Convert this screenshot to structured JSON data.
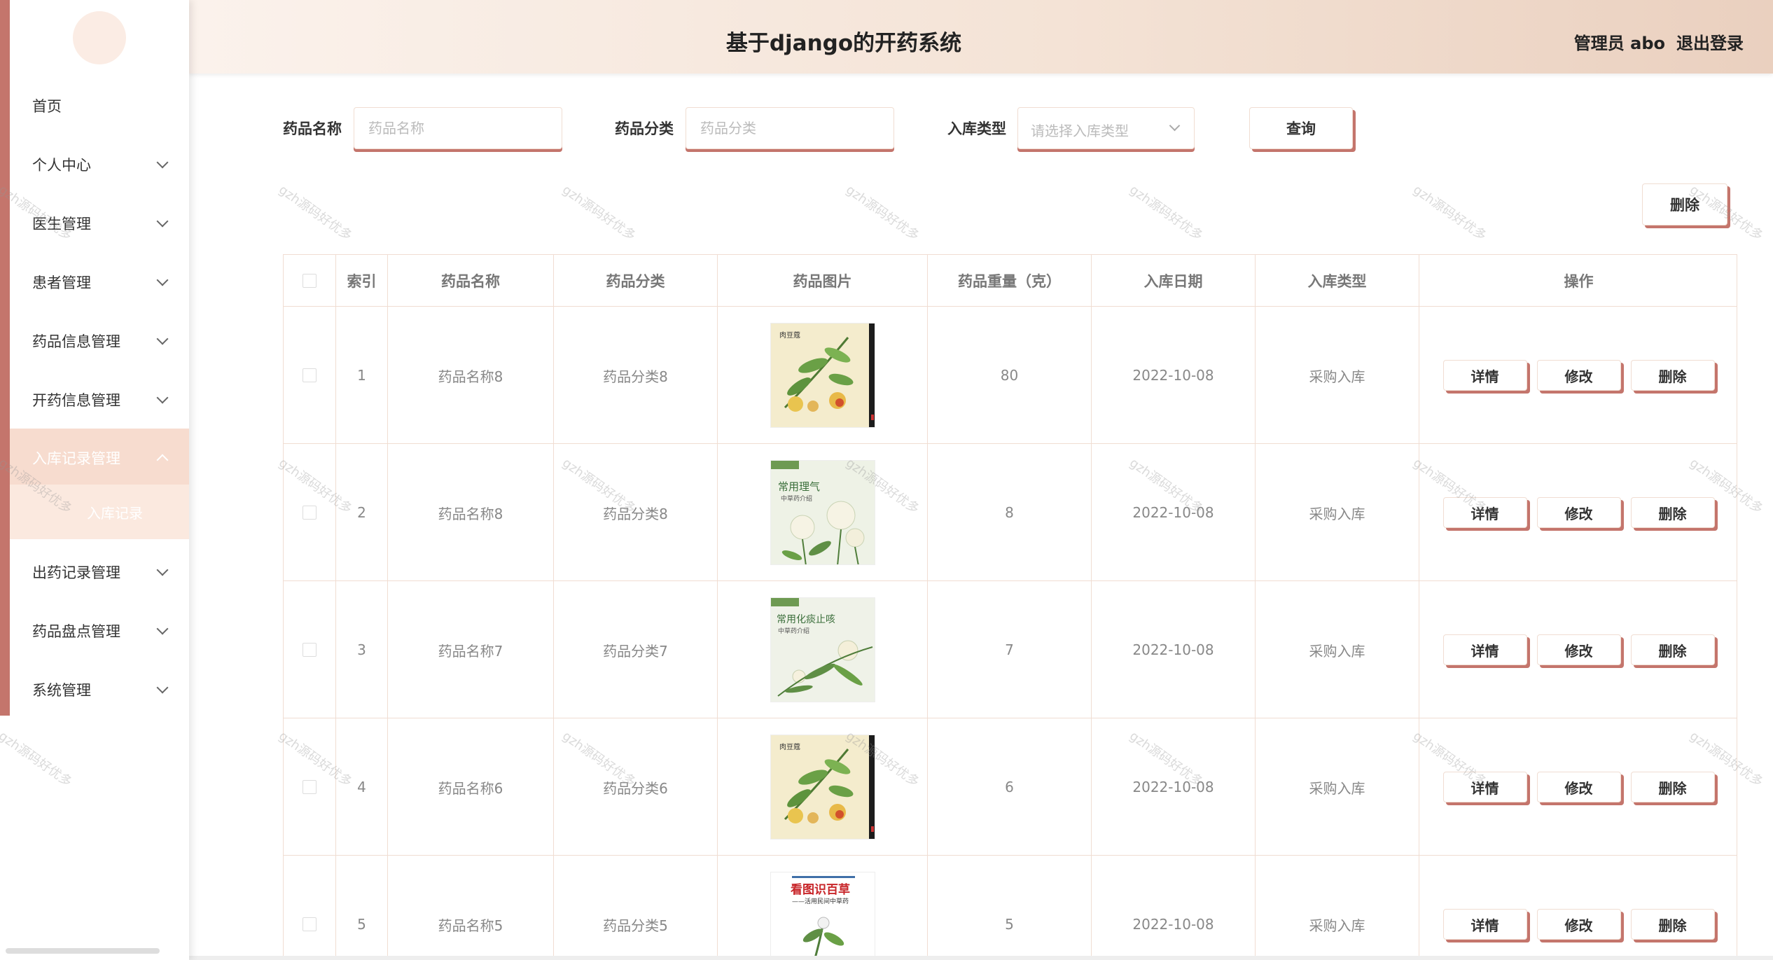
{
  "header": {
    "title": "基于django的开药系统",
    "user_label": "管理员 abo",
    "logout_label": "退出登录"
  },
  "sidebar": {
    "items": [
      {
        "label": "首页"
      },
      {
        "label": "个人中心"
      },
      {
        "label": "医生管理"
      },
      {
        "label": "患者管理"
      },
      {
        "label": "药品信息管理"
      },
      {
        "label": "开药信息管理"
      },
      {
        "label": "入库记录管理"
      },
      {
        "label": "出药记录管理"
      },
      {
        "label": "药品盘点管理"
      },
      {
        "label": "系统管理"
      }
    ],
    "submenu": {
      "label": "入库记录"
    }
  },
  "search": {
    "name_label": "药品名称",
    "name_placeholder": "药品名称",
    "category_label": "药品分类",
    "category_placeholder": "药品分类",
    "type_label": "入库类型",
    "type_placeholder": "请选择入库类型",
    "query_label": "查询"
  },
  "toolbar": {
    "delete_label": "删除"
  },
  "table": {
    "columns": [
      "索引",
      "药品名称",
      "药品分类",
      "药品图片",
      "药品重量（克）",
      "入库日期",
      "入库类型",
      "操作"
    ],
    "actions": {
      "detail": "详情",
      "edit": "修改",
      "delete": "删除"
    },
    "rows": [
      {
        "index": "1",
        "name": "药品名称8",
        "category": "药品分类8",
        "image": "herb-book-cover-1",
        "weight": "80",
        "date": "2022-10-08",
        "type": "采购入库"
      },
      {
        "index": "2",
        "name": "药品名称8",
        "category": "药品分类8",
        "image": "herb-book-cover-2",
        "weight": "8",
        "date": "2022-10-08",
        "type": "采购入库"
      },
      {
        "index": "3",
        "name": "药品名称7",
        "category": "药品分类7",
        "image": "herb-book-cover-3",
        "weight": "7",
        "date": "2022-10-08",
        "type": "采购入库"
      },
      {
        "index": "4",
        "name": "药品名称6",
        "category": "药品分类6",
        "image": "herb-book-cover-1",
        "weight": "6",
        "date": "2022-10-08",
        "type": "采购入库"
      },
      {
        "index": "5",
        "name": "药品名称5",
        "category": "药品分类5",
        "image": "herb-book-cover-4",
        "weight": "5",
        "date": "2022-10-08",
        "type": "采购入库"
      }
    ]
  },
  "covers": {
    "c1": {
      "text": "肉豆蔻"
    },
    "c2": {
      "text": "常用理气",
      "sub": "中草药介绍"
    },
    "c3": {
      "text": "常用化痰止咳",
      "sub": "中草药介绍"
    },
    "c4": {
      "text": "看图识百草",
      "sub": "——活用民间中草药"
    }
  },
  "watermark": {
    "text": "gzh源码好优多"
  },
  "colors": {
    "accent": "#c4756c",
    "header_start": "#fbf2ec",
    "header_end": "#ead0bf",
    "active_menu": "#f7dccf"
  }
}
